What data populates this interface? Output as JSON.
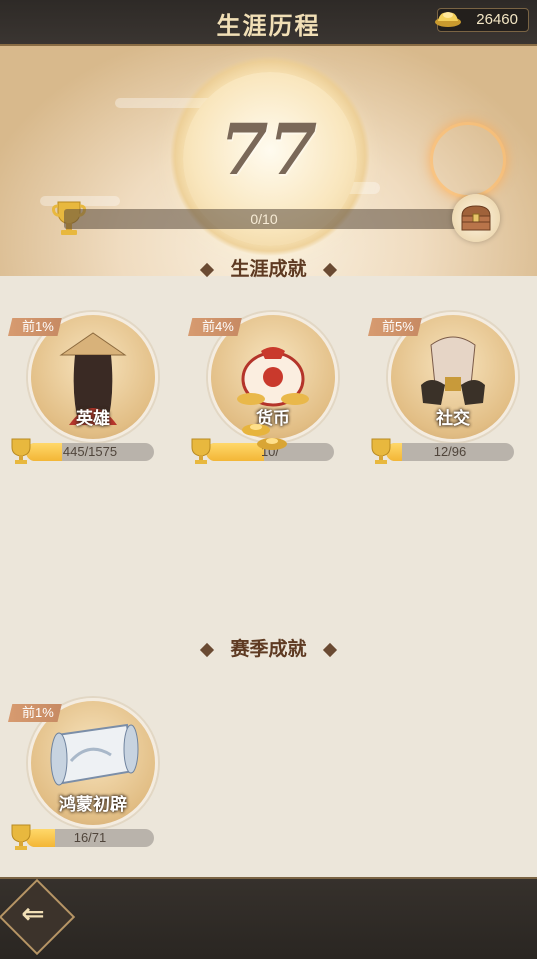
{
  "header": {
    "title": "生涯历程",
    "currency_amount": "26460",
    "currency_icon": "gold-ingot-icon"
  },
  "banner": {
    "score": "77",
    "progress_text": "0/10",
    "progress_fraction": 0.0
  },
  "sections": {
    "career_title": "生涯成就",
    "season_title": "赛季成就"
  },
  "career_cards": [
    {
      "rank": "前1%",
      "label": "英雄",
      "progress": "445/1575",
      "fraction": 0.28,
      "icon": "hero-portrait-icon"
    },
    {
      "rank": "前4%",
      "label": "货币",
      "progress": "10/",
      "fraction": 0.45,
      "icon": "money-bag-icon"
    },
    {
      "rank": "前5%",
      "label": "社交",
      "progress": "12/96",
      "fraction": 0.125,
      "icon": "handshake-icon"
    }
  ],
  "season_cards": [
    {
      "rank": "前1%",
      "label": "鸿蒙初辟",
      "progress": "16/71",
      "fraction": 0.225,
      "icon": "scroll-map-icon"
    }
  ],
  "nav": {
    "back_icon": "back-arrow-icon"
  },
  "colors": {
    "accent": "#f3b636",
    "title": "#f1dfb6",
    "section": "#5e3a22"
  }
}
